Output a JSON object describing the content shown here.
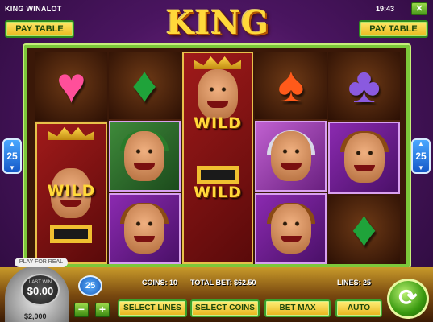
{
  "header": {
    "game_name": "KING WINALOT",
    "logo": "KING WINALOT",
    "clock": "19:43",
    "close_label": "✕",
    "pay_table_left": "PAY TABLE",
    "pay_table_right": "PAY TABLE"
  },
  "side": {
    "lines_left": "25",
    "lines_right": "25"
  },
  "reels": [
    [
      "heart",
      "king-wild",
      "king-wild"
    ],
    [
      "diamond",
      "jester",
      "prince"
    ],
    [
      "king-wild",
      "king-wild",
      "king-wild"
    ],
    [
      "spade",
      "queen",
      "prince"
    ],
    [
      "club",
      "prince",
      "diamond"
    ]
  ],
  "wild_label": "WILD",
  "status": {
    "coins": "COINS: 10",
    "total_bet": "TOTAL BET: $62.50",
    "lines": "LINES: 25"
  },
  "controls": {
    "coin_value": "25",
    "minus": "−",
    "plus": "+",
    "select_lines": "SELECT LINES",
    "select_coins": "SELECT COINS",
    "bet_max": "BET MAX",
    "auto": "AUTO",
    "spin": "⟳"
  },
  "wallet": {
    "play_for_real": "PLAY FOR REAL",
    "last_win_label": "LAST WIN",
    "last_win_value": "$0.00",
    "balance": "$2,000"
  },
  "colors": {
    "frame": "#7cc83a",
    "button_fill": "#f0c030",
    "badge_blue": "#1458c8"
  }
}
